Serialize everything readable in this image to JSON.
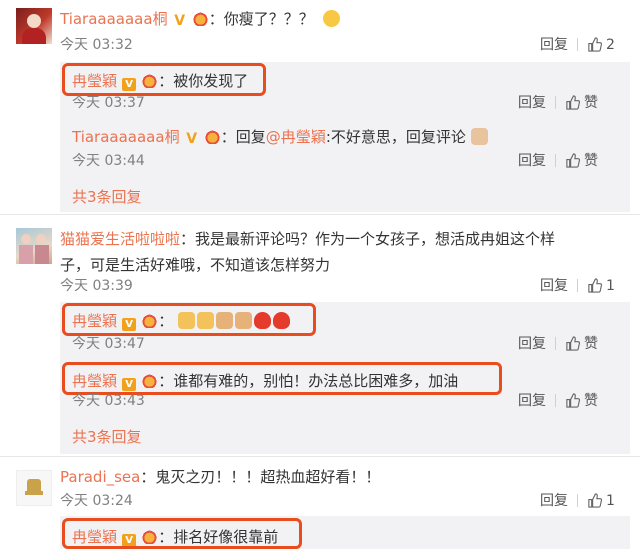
{
  "c1": {
    "name": "Tiaraaaaaaa桐",
    "sep": "：",
    "text": "你瘦了？？？",
    "time": "今天 03:32",
    "reply": "回复",
    "likes": "2",
    "replies": [
      {
        "name": "冉瑩穎",
        "sep": "：",
        "text": "被你发现了",
        "time": "今天 03:37",
        "reply": "回复",
        "likes": "赞"
      },
      {
        "name": "Tiaraaaaaaa桐",
        "sep": "：",
        "prefix": "回复",
        "at": "@冉瑩穎",
        "text": ":不好意思，回复评论",
        "time": "今天 03:44",
        "reply": "回复",
        "likes": "赞"
      }
    ],
    "more": "共3条回复"
  },
  "c2": {
    "name": "猫猫爱生活啦啦啦",
    "sep": "：",
    "line1": "我是最新评论吗？作为一个女孩子，想活成冉姐这个样",
    "line2": "子，可是生活好难哦，不知道该怎样努力",
    "time": "今天 03:39",
    "reply": "回复",
    "likes": "1",
    "replies": [
      {
        "name": "冉瑩穎",
        "sep": "：",
        "time": "今天 03:47",
        "reply": "回复",
        "likes": "赞"
      },
      {
        "name": "冉瑩穎",
        "sep": "：",
        "text": "谁都有难的，别怕！办法总比困难多，加油",
        "time": "今天 03:43",
        "reply": "回复",
        "likes": "赞"
      }
    ],
    "more": "共3条回复"
  },
  "c3": {
    "name": "Paradi_sea",
    "sep": "：",
    "text": "鬼灭之刃！！！超热血超好看！！",
    "time": "今天 03:24",
    "reply": "回复",
    "likes": "1",
    "replies": [
      {
        "name": "冉瑩穎",
        "sep": "：",
        "text": "排名好像很靠前"
      }
    ]
  },
  "colors": {
    "name": "#eb7350",
    "highlight": "#e94d1e",
    "reply_bg": "#f2f2f5"
  }
}
